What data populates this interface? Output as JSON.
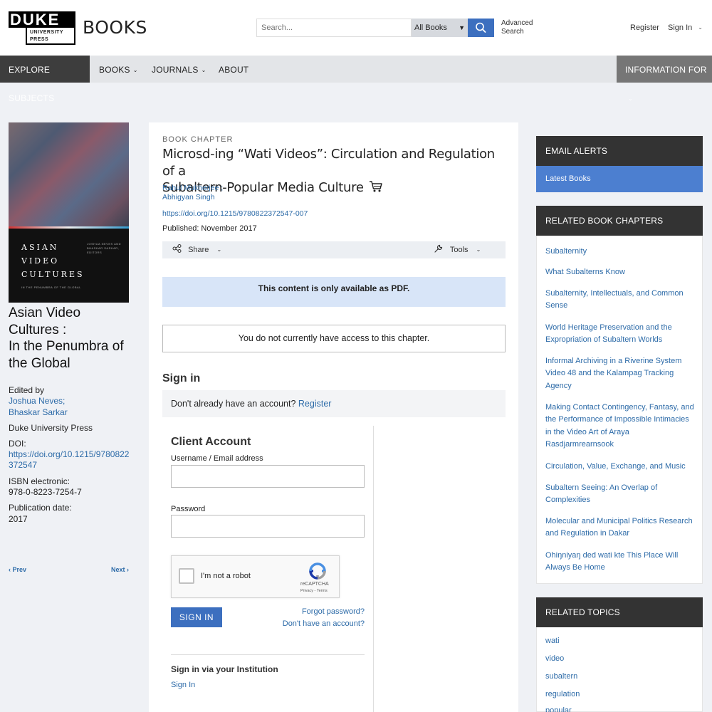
{
  "header": {
    "logo_main": "DUKE",
    "logo_sub_1": "UNIVERSITY",
    "logo_sub_2": "PRESS",
    "section": "BOOKS",
    "search_placeholder": "Search...",
    "search_scope": "All Books",
    "advanced_search_1": "Advanced",
    "advanced_search_2": "Search",
    "register": "Register",
    "sign_in": "Sign In"
  },
  "nav": {
    "explore": "EXPLORE SUBJECTS",
    "books": "BOOKS",
    "journals": "JOURNALS",
    "about": "ABOUT",
    "info_for": "INFORMATION FOR"
  },
  "book": {
    "cover_title": [
      "ASIAN",
      "VIDEO",
      "CULTURES"
    ],
    "cover_editors": "JOSHUA NEVES AND BHASKAR SARKAR, EDITORS",
    "cover_subtitle": "IN THE PENUMBRA OF THE GLOBAL",
    "title_line1": "Asian Video",
    "title_line2": "Cultures :",
    "title_line3": "In the Penumbra of",
    "title_line4": "the Global",
    "edited_by": "Edited by",
    "editors": [
      "Joshua Neves;",
      "Bhaskar Sarkar"
    ],
    "publisher": "Duke University Press",
    "doi_label": "DOI:",
    "doi": "https://doi.org/10.1215/9780822372547",
    "isbn_label": "ISBN electronic:",
    "isbn": "978-0-8223-7254-7",
    "pubdate_label": "Publication date:",
    "pubdate": "2017",
    "prev": "‹ Prev",
    "next": "Next ›"
  },
  "chapter": {
    "label": "BOOK CHAPTER",
    "title_line1": "Microsd-ing “Wati Videos”: Circulation and Regulation of a",
    "title_line2": "Subaltern-Popular Media Culture",
    "authors": [
      "Rahul Mukherjee ;",
      "Abhigyan Singh"
    ],
    "doi": "https://doi.org/10.1215/9780822372547-007",
    "published": "Published: November 2017",
    "share": "Share",
    "tools": "Tools",
    "pdf_notice": "This content is only available as PDF.",
    "access_notice": "You do not currently have access to this chapter."
  },
  "signin": {
    "heading": "Sign in",
    "no_account_text": "Don't already have an account?",
    "no_account_link": "Register",
    "client_account": "Client Account",
    "username_label": "Username / Email address",
    "password_label": "Password",
    "recaptcha_label": "I'm not a robot",
    "recaptcha_brand": "reCAPTCHA",
    "recaptcha_terms": "Privacy - Terms",
    "button": "SIGN IN",
    "forgot": "Forgot password?",
    "dont_have": "Don't have an account?",
    "institution_heading": "Sign in via your Institution",
    "institution_link": "Sign In"
  },
  "sidebar": {
    "email_alerts": "EMAIL ALERTS",
    "latest_books": "Latest Books",
    "related_chapters_heading": "RELATED BOOK CHAPTERS",
    "related_chapters": [
      "Subalternity",
      "What Subalterns Know",
      "Subalternity, Intellectuals, and Common Sense",
      "World Heritage Preservation and the Expropriation of Subaltern Worlds",
      "Informal Archiving in a Riverine System Video 48 and the Kalampag Tracking Agency",
      "Making Contact Contingency, Fantasy, and the Performance of Impossible Intimacies in the Video Art of Araya Rasdjarmrearnsook",
      "Circulation, Value, Exchange, and Music",
      "Subaltern Seeing: An Overlap of Complexities",
      "Molecular and Municipal Politics Research and Regulation in Dakar",
      "Ohiŋniyaŋ ded wati kte This Place Will Always Be Home"
    ],
    "related_topics_heading": "RELATED TOPICS",
    "related_topics": [
      "wati",
      "video",
      "subaltern",
      "regulation",
      "popular"
    ]
  },
  "colors": {
    "accent_blue": "#3c6fbf",
    "link_blue": "#2d6ba8",
    "nav_dark": "#3d3d3d",
    "pdf_notice_bg": "#d8e5f8"
  }
}
